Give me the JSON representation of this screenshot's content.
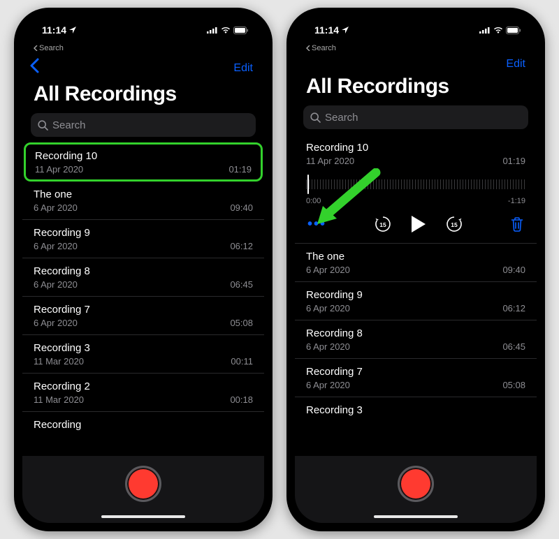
{
  "status": {
    "time": "11:14",
    "breadcrumb": "Search"
  },
  "nav": {
    "edit": "Edit"
  },
  "title": "All Recordings",
  "search": {
    "placeholder": "Search"
  },
  "left": {
    "items": [
      {
        "name": "Recording 10",
        "date": "11 Apr 2020",
        "duration": "01:19"
      },
      {
        "name": "The one",
        "date": "6 Apr 2020",
        "duration": "09:40"
      },
      {
        "name": "Recording 9",
        "date": "6 Apr 2020",
        "duration": "06:12"
      },
      {
        "name": "Recording 8",
        "date": "6 Apr 2020",
        "duration": "06:45"
      },
      {
        "name": "Recording 7",
        "date": "6 Apr 2020",
        "duration": "05:08"
      },
      {
        "name": "Recording 3",
        "date": "11 Mar 2020",
        "duration": "00:11"
      },
      {
        "name": "Recording 2",
        "date": "11 Mar 2020",
        "duration": "00:18"
      },
      {
        "name": "Recording",
        "date": "",
        "duration": ""
      }
    ]
  },
  "right": {
    "expanded": {
      "name": "Recording 10",
      "date": "11 Apr 2020",
      "duration": "01:19",
      "elapsed": "0:00",
      "remaining": "-1:19"
    },
    "items": [
      {
        "name": "The one",
        "date": "6 Apr 2020",
        "duration": "09:40"
      },
      {
        "name": "Recording 9",
        "date": "6 Apr 2020",
        "duration": "06:12"
      },
      {
        "name": "Recording 8",
        "date": "6 Apr 2020",
        "duration": "06:45"
      },
      {
        "name": "Recording 7",
        "date": "6 Apr 2020",
        "duration": "05:08"
      },
      {
        "name": "Recording 3",
        "date": "",
        "duration": ""
      }
    ]
  },
  "controls": {
    "more": "•••",
    "skip_back": "15",
    "skip_fwd": "15"
  }
}
